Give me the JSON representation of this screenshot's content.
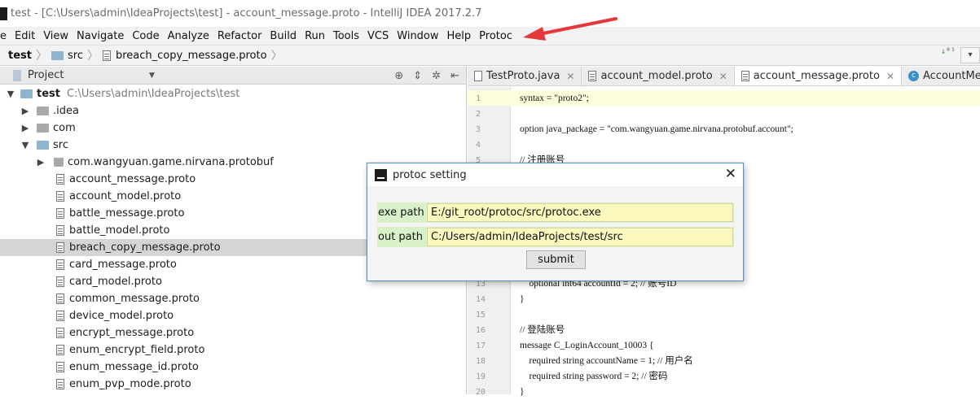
{
  "titlebar": {
    "title": "test - [C:\\Users\\admin\\IdeaProjects\\test] - account_message.proto - IntelliJ IDEA 2017.2.7"
  },
  "menubar": {
    "items": [
      {
        "label": "e"
      },
      {
        "label": "Edit"
      },
      {
        "label": "View"
      },
      {
        "label": "Navigate"
      },
      {
        "label": "Code"
      },
      {
        "label": "Analyze"
      },
      {
        "label": "Refactor"
      },
      {
        "label": "Build"
      },
      {
        "label": "Run"
      },
      {
        "label": "Tools"
      },
      {
        "label": "VCS"
      },
      {
        "label": "Window"
      },
      {
        "label": "Help"
      },
      {
        "label": "Protoc"
      }
    ]
  },
  "breadcrumb": {
    "items": [
      "test",
      "src",
      "breach_copy_message.proto"
    ]
  },
  "project_panel": {
    "title": "Project",
    "tree": [
      {
        "label": "test",
        "path": "C:\\Users\\admin\\IdeaProjects\\test"
      },
      {
        "label": ".idea"
      },
      {
        "label": "com"
      },
      {
        "label": "src"
      },
      {
        "label": "com.wangyuan.game.nirvana.protobuf"
      },
      {
        "label": "account_message.proto"
      },
      {
        "label": "account_model.proto"
      },
      {
        "label": "battle_message.proto"
      },
      {
        "label": "battle_model.proto"
      },
      {
        "label": "breach_copy_message.proto"
      },
      {
        "label": "card_message.proto"
      },
      {
        "label": "card_model.proto"
      },
      {
        "label": "common_message.proto"
      },
      {
        "label": "device_model.proto"
      },
      {
        "label": "encrypt_message.proto"
      },
      {
        "label": "enum_encrypt_field.proto"
      },
      {
        "label": "enum_message_id.proto"
      },
      {
        "label": "enum_pvp_mode.proto"
      }
    ]
  },
  "editor": {
    "tabs": [
      {
        "label": "TestProto.java"
      },
      {
        "label": "account_model.proto"
      },
      {
        "label": "account_message.proto"
      },
      {
        "label": "AccountMessage.ja"
      }
    ],
    "line_numbers": [
      "1",
      "2",
      "3",
      "4",
      "5",
      "13",
      "14",
      "15",
      "16",
      "17",
      "18",
      "19",
      "20"
    ],
    "code_lines": [
      "syntax = \"proto2\";",
      "",
      "option java_package = \"com.wangyuan.game.nirvana.protobuf.account\";",
      "",
      "// 注册账号",
      "    optional int64 accountId = 2; // 账号ID",
      "}",
      "",
      "// 登陆账号",
      "message C_LoginAccount_10003 {",
      "    required string accountName = 1; // 用户名",
      "    required string password = 2; // 密码",
      "}"
    ]
  },
  "dialog": {
    "title": "protoc setting",
    "exe_label": "exe path",
    "exe_value": "E:/git_root/protoc/src/protoc.exe",
    "out_label": "out path",
    "out_value": "C:/Users/admin/IdeaProjects/test/src",
    "submit_label": "submit"
  },
  "colors": {
    "accent_arrow": "#e5383b",
    "dialog_border": "#5b8ed4",
    "form_row_bg": "#d9f1c9",
    "input_bg": "#fbf8bd"
  }
}
